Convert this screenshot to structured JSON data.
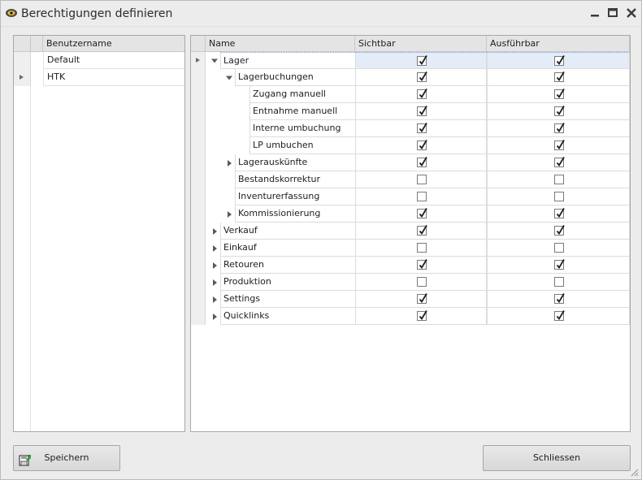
{
  "window": {
    "title": "Berechtigungen definieren"
  },
  "users": {
    "header": "Benutzername",
    "rows": [
      {
        "name": "Default",
        "selected": false
      },
      {
        "name": "HTK",
        "selected": true
      }
    ]
  },
  "permissions": {
    "headers": {
      "name": "Name",
      "visible": "Sichtbar",
      "executable": "Ausführbar"
    },
    "rows": [
      {
        "label": "Lager",
        "level": 0,
        "expander": "expanded",
        "visible": true,
        "executable": true,
        "current": true
      },
      {
        "label": "Lagerbuchungen",
        "level": 1,
        "expander": "expanded",
        "visible": true,
        "executable": true
      },
      {
        "label": "Zugang manuell",
        "level": 2,
        "expander": "none",
        "visible": true,
        "executable": true
      },
      {
        "label": "Entnahme manuell",
        "level": 2,
        "expander": "none",
        "visible": true,
        "executable": true
      },
      {
        "label": "Interne umbuchung",
        "level": 2,
        "expander": "none",
        "visible": true,
        "executable": true
      },
      {
        "label": "LP umbuchen",
        "level": 2,
        "expander": "none",
        "visible": true,
        "executable": true
      },
      {
        "label": "Lagerauskünfte",
        "level": 1,
        "expander": "collapsed",
        "visible": true,
        "executable": true
      },
      {
        "label": "Bestandskorrektur",
        "level": 1,
        "expander": "none",
        "visible": false,
        "executable": false
      },
      {
        "label": "Inventurerfassung",
        "level": 1,
        "expander": "none",
        "visible": false,
        "executable": false
      },
      {
        "label": "Kommissionierung",
        "level": 1,
        "expander": "collapsed",
        "visible": true,
        "executable": true
      },
      {
        "label": "Verkauf",
        "level": 0,
        "expander": "collapsed",
        "visible": true,
        "executable": true
      },
      {
        "label": "Einkauf",
        "level": 0,
        "expander": "collapsed",
        "visible": false,
        "executable": false
      },
      {
        "label": "Retouren",
        "level": 0,
        "expander": "collapsed",
        "visible": true,
        "executable": true
      },
      {
        "label": "Produktion",
        "level": 0,
        "expander": "collapsed",
        "visible": false,
        "executable": false
      },
      {
        "label": "Settings",
        "level": 0,
        "expander": "collapsed",
        "visible": true,
        "executable": true
      },
      {
        "label": "Quicklinks",
        "level": 0,
        "expander": "collapsed",
        "visible": true,
        "executable": true
      }
    ]
  },
  "buttons": {
    "save": "Speichern",
    "close": "Schliessen"
  },
  "icons": {
    "app": "eye-icon",
    "save": "save-icon",
    "minimize": "minimize-icon",
    "maximize": "maximize-icon",
    "close": "close-icon"
  },
  "colors": {
    "selection": "#e3ecf7",
    "save_icon_green": "#2e9a3a"
  }
}
